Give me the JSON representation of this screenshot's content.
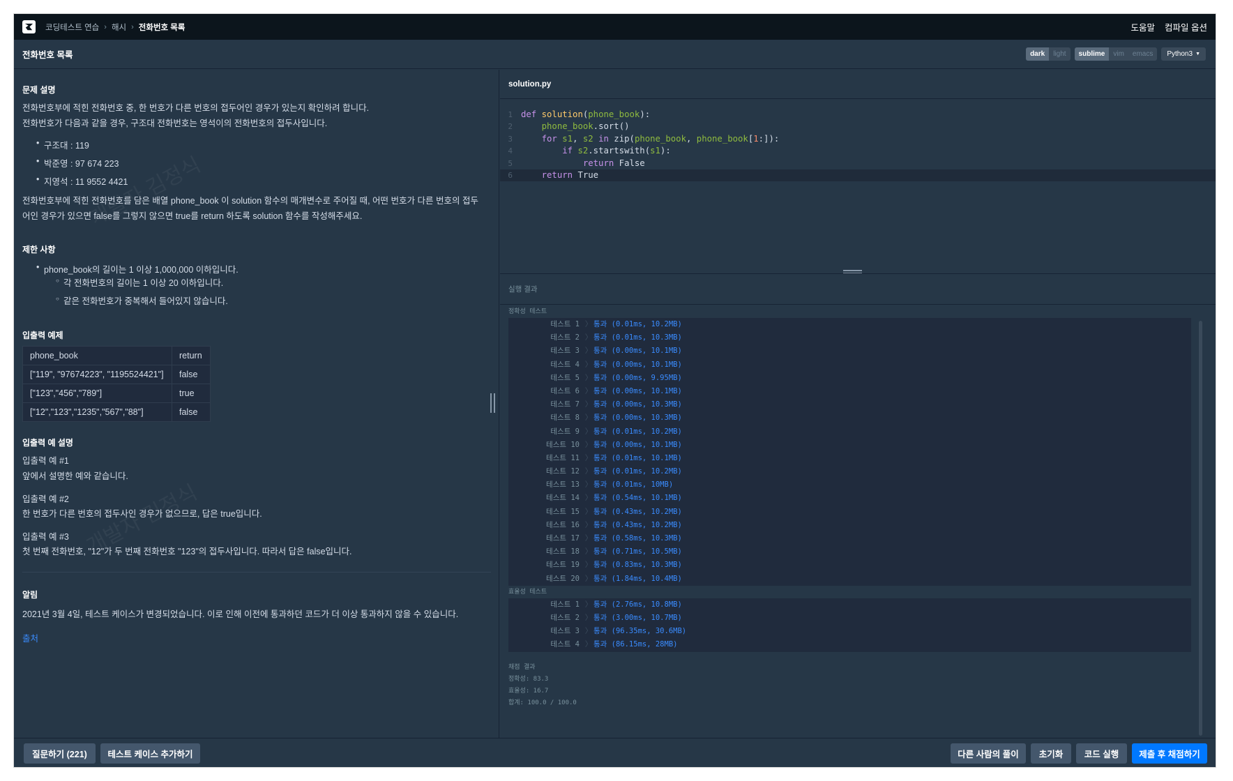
{
  "nav": {
    "breadcrumb": [
      "코딩테스트 연습",
      "해시",
      "전화번호 목록"
    ],
    "links": [
      "도움말",
      "컴파일 옵션"
    ]
  },
  "header": {
    "title": "전화번호 목록",
    "theme_options": [
      "dark",
      "light"
    ],
    "theme_selected": "dark",
    "keymap_options": [
      "sublime",
      "vim",
      "emacs"
    ],
    "keymap_selected": "sublime",
    "language": "Python3"
  },
  "problem": {
    "desc_title": "문제 설명",
    "desc_lines": [
      "전화번호부에 적힌 전화번호 중, 한 번호가 다른 번호의 접두어인 경우가 있는지 확인하려 합니다.",
      "전화번호가 다음과 같을 경우, 구조대 전화번호는 영석이의 전화번호의 접두사입니다."
    ],
    "examples": [
      "구조대 : 119",
      "박준영 : 97 674 223",
      "지영석 : 11 9552 4421"
    ],
    "task_lines": [
      "전화번호부에 적힌 전화번호를 담은 배열 phone_book 이 solution 함수의 매개변수로 주어질 때, 어떤 번호가 다른 번호의 접두",
      "어인 경우가 있으면 false를 그렇지 않으면 true를 return 하도록 solution 함수를 작성해주세요."
    ],
    "constraints_title": "제한 사항",
    "constraint_main": "phone_book의 길이는 1 이상 1,000,000 이하입니다.",
    "constraint_subs": [
      "각 전화번호의 길이는 1 이상 20 이하입니다.",
      "같은 전화번호가 중복해서 들어있지 않습니다."
    ],
    "io_title": "입출력 예제",
    "io_headers": [
      "phone_book",
      "return"
    ],
    "io_rows": [
      [
        "[\"119\", \"97674223\", \"1195524421\"]",
        "false"
      ],
      [
        "[\"123\",\"456\",\"789\"]",
        "true"
      ],
      [
        "[\"12\",\"123\",\"1235\",\"567\",\"88\"]",
        "false"
      ]
    ],
    "io_explain_title": "입출력 예 설명",
    "explains": [
      {
        "title": "입출력 예 #1",
        "body": "앞에서 설명한 예와 같습니다."
      },
      {
        "title": "입출력 예 #2",
        "body": "한 번호가 다른 번호의 접두사인 경우가 없으므로, 답은 true입니다."
      },
      {
        "title": "입출력 예 #3",
        "body": "첫 번째 전화번호, \"12\"가 두 번째 전화번호 \"123\"의 접두사입니다. 따라서 답은 false입니다."
      }
    ],
    "notice_title": "알림",
    "notice_body": "2021년 3월 4일, 테스트 케이스가 변경되었습니다. 이로 인해 이전에 통과하던 코드가 더 이상 통과하지 않을 수 있습니다.",
    "source_link": "출처",
    "watermark": "개발자 김정식"
  },
  "editor": {
    "filename": "solution.py",
    "line_numbers": [
      "1",
      "2",
      "3",
      "4",
      "5",
      "6"
    ]
  },
  "results": {
    "title": "실행 결과",
    "accuracy_label": "정확성  테스트",
    "accuracy_tests": [
      {
        "name": "테스트 1",
        "result": "통과 (0.01ms, 10.2MB)"
      },
      {
        "name": "테스트 2",
        "result": "통과 (0.01ms, 10.3MB)"
      },
      {
        "name": "테스트 3",
        "result": "통과 (0.00ms, 10.1MB)"
      },
      {
        "name": "테스트 4",
        "result": "통과 (0.00ms, 10.1MB)"
      },
      {
        "name": "테스트 5",
        "result": "통과 (0.00ms, 9.95MB)"
      },
      {
        "name": "테스트 6",
        "result": "통과 (0.00ms, 10.1MB)"
      },
      {
        "name": "테스트 7",
        "result": "통과 (0.00ms, 10.3MB)"
      },
      {
        "name": "테스트 8",
        "result": "통과 (0.00ms, 10.3MB)"
      },
      {
        "name": "테스트 9",
        "result": "통과 (0.01ms, 10.2MB)"
      },
      {
        "name": "테스트 10",
        "result": "통과 (0.00ms, 10.1MB)"
      },
      {
        "name": "테스트 11",
        "result": "통과 (0.01ms, 10.1MB)"
      },
      {
        "name": "테스트 12",
        "result": "통과 (0.01ms, 10.2MB)"
      },
      {
        "name": "테스트 13",
        "result": "통과 (0.01ms, 10MB)"
      },
      {
        "name": "테스트 14",
        "result": "통과 (0.54ms, 10.1MB)"
      },
      {
        "name": "테스트 15",
        "result": "통과 (0.43ms, 10.2MB)"
      },
      {
        "name": "테스트 16",
        "result": "통과 (0.43ms, 10.2MB)"
      },
      {
        "name": "테스트 17",
        "result": "통과 (0.58ms, 10.3MB)"
      },
      {
        "name": "테스트 18",
        "result": "통과 (0.71ms, 10.5MB)"
      },
      {
        "name": "테스트 19",
        "result": "통과 (0.83ms, 10.3MB)"
      },
      {
        "name": "테스트 20",
        "result": "통과 (1.84ms, 10.4MB)"
      }
    ],
    "efficiency_label": "효율성  테스트",
    "efficiency_tests": [
      {
        "name": "테스트 1",
        "result": "통과 (2.76ms, 10.8MB)"
      },
      {
        "name": "테스트 2",
        "result": "통과 (3.00ms, 10.7MB)"
      },
      {
        "name": "테스트 3",
        "result": "통과 (96.35ms, 30.6MB)"
      },
      {
        "name": "테스트 4",
        "result": "통과 (86.15ms, 28MB)"
      }
    ],
    "score_title": "채점 결과",
    "score_lines": [
      "정확성: 83.3",
      "효율성: 16.7",
      "합계: 100.0 / 100.0"
    ]
  },
  "footer": {
    "ask": "질문하기 (221)",
    "add_tc": "테스트 케이스 추가하기",
    "others": "다른 사람의 풀이",
    "reset": "초기화",
    "run": "코드 실행",
    "submit": "제출 후 채점하기"
  },
  "colors": {
    "accent": "#0078ff",
    "pass": "#3a8cff",
    "background": "#263747",
    "navbar": "#0c151c"
  }
}
